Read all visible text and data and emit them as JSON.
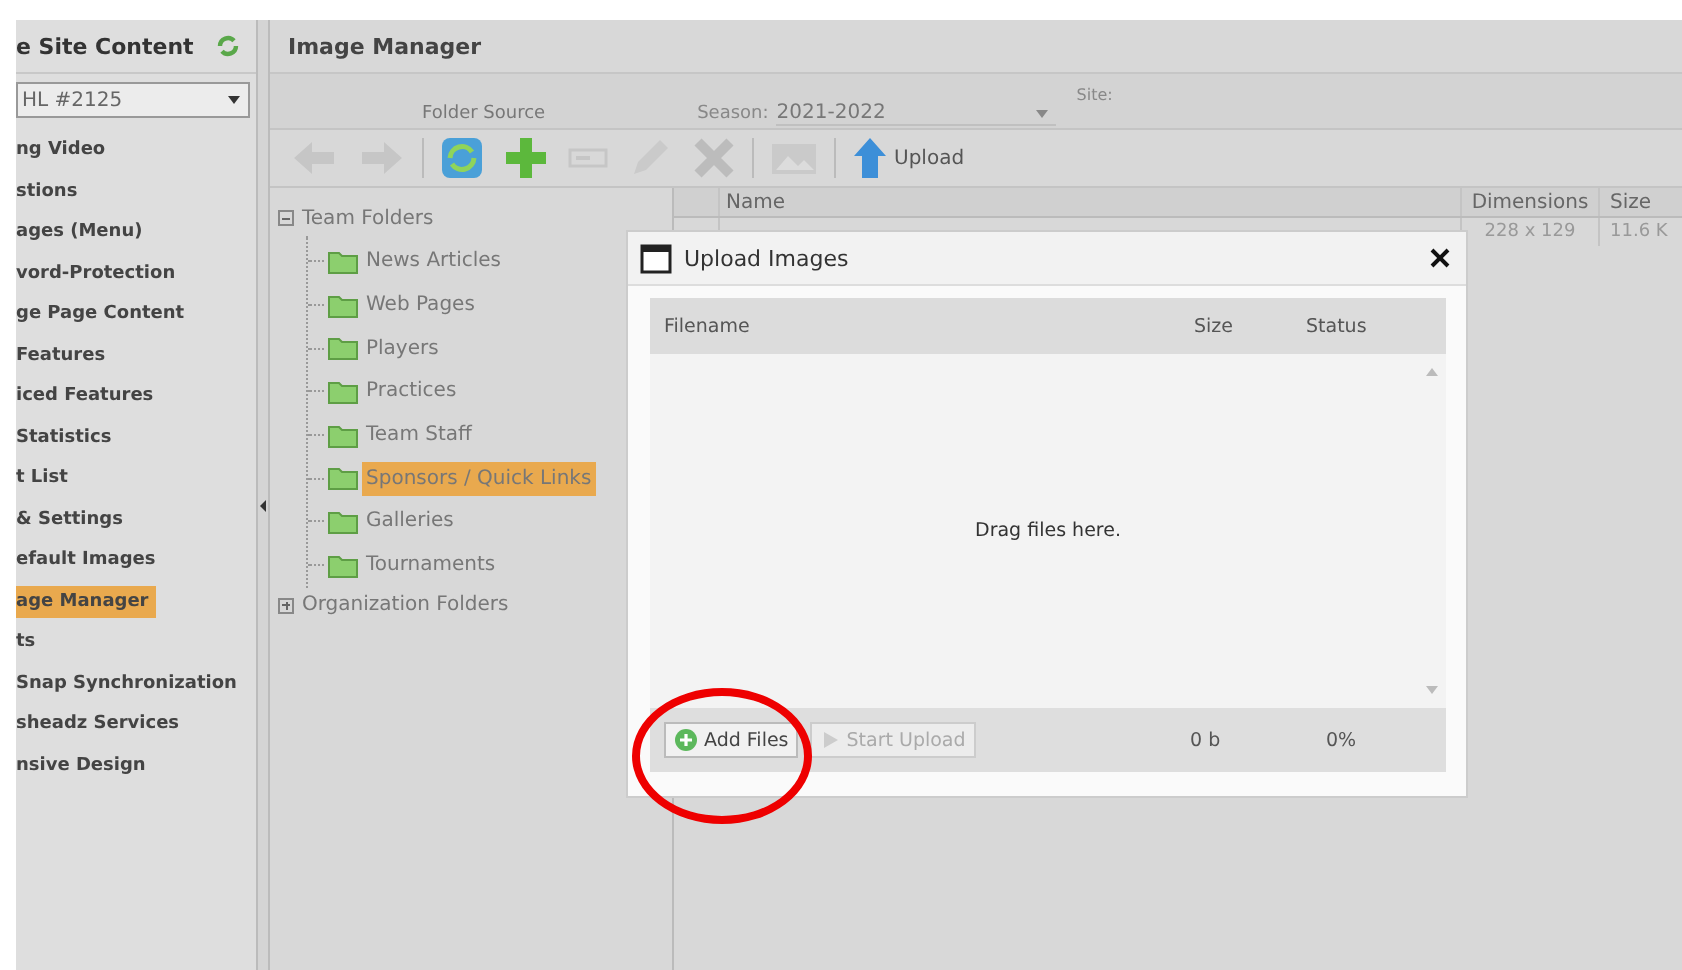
{
  "sidebar": {
    "title": "e Site Content",
    "dropdown": "HL #2125",
    "items": [
      {
        "label": "ng Video",
        "selected": false
      },
      {
        "label": "stions",
        "selected": false
      },
      {
        "label": "ages (Menu)",
        "selected": false
      },
      {
        "label": "vord-Protection",
        "selected": false
      },
      {
        "label": "ge Page Content",
        "selected": false
      },
      {
        "label": "Features",
        "selected": false
      },
      {
        "label": "iced Features",
        "selected": false
      },
      {
        "label": "Statistics",
        "selected": false
      },
      {
        "label": "t List",
        "selected": false
      },
      {
        "label": "& Settings",
        "selected": false
      },
      {
        "label": "efault Images",
        "selected": false
      },
      {
        "label": "age Manager",
        "selected": true
      },
      {
        "label": "ts",
        "selected": false
      },
      {
        "label": "Snap Synchronization",
        "selected": false
      },
      {
        "label": "sheadz Services",
        "selected": false
      },
      {
        "label": "nsive Design",
        "selected": false
      }
    ]
  },
  "main": {
    "title": "Image Manager",
    "folder_source_label": "Folder Source",
    "season_label": "Season:",
    "season_value": "2021-2022",
    "site_label": "Site:",
    "toolbar": [
      {
        "kind": "back",
        "disabled": true
      },
      {
        "kind": "forward",
        "disabled": true
      },
      {
        "kind": "refresh",
        "disabled": false
      },
      {
        "kind": "add",
        "disabled": false
      },
      {
        "kind": "rename",
        "disabled": true
      },
      {
        "kind": "edit",
        "disabled": true
      },
      {
        "kind": "delete",
        "disabled": true
      },
      {
        "kind": "image",
        "disabled": true
      },
      {
        "kind": "upload",
        "disabled": false,
        "label": "Upload"
      }
    ]
  },
  "tree": [
    {
      "label": "Team Folders",
      "expanded": true,
      "children": [
        {
          "label": "News Articles",
          "selected": false
        },
        {
          "label": "Web Pages",
          "selected": false
        },
        {
          "label": "Players",
          "selected": false
        },
        {
          "label": "Practices",
          "selected": false
        },
        {
          "label": "Team Staff",
          "selected": false
        },
        {
          "label": "Sponsors / Quick Links",
          "selected": true
        },
        {
          "label": "Galleries",
          "selected": false
        },
        {
          "label": "Tournaments",
          "selected": false
        }
      ]
    },
    {
      "label": "Organization Folders",
      "expanded": false
    }
  ],
  "file_table": {
    "columns": [
      "Name",
      "Dimensions",
      "Size"
    ],
    "rows": [
      {
        "dimensions": "228 x 129",
        "size": "11.6 K"
      }
    ]
  },
  "dialog": {
    "title": "Upload Images",
    "columns": [
      "Filename",
      "Size",
      "Status"
    ],
    "drop_hint": "Drag files here.",
    "buttons": [
      {
        "label": "Add Files",
        "disabled": false,
        "highlighted": true
      },
      {
        "label": "Start Upload",
        "disabled": true,
        "highlighted": false
      }
    ],
    "total_size": "0 b",
    "progress": "0%"
  }
}
